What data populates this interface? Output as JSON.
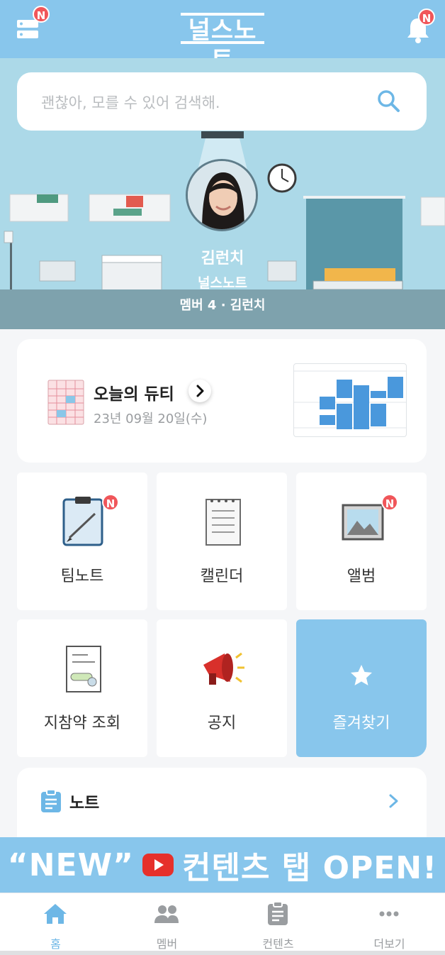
{
  "header": {
    "logo_text": "널스노트",
    "left_badge": "N",
    "right_badge": "N"
  },
  "search": {
    "placeholder": "괜찮아, 모를 수 있어 검색해."
  },
  "profile": {
    "name": "김런치",
    "team": "널스노트",
    "member_line": "멤버 4 · 김런치"
  },
  "duty": {
    "title": "오늘의 듀티",
    "date": "23년 09월 20일(수)"
  },
  "tiles": [
    {
      "label": "팀노트",
      "badge": "N"
    },
    {
      "label": "캘린더",
      "badge": ""
    },
    {
      "label": "앨범",
      "badge": "N"
    },
    {
      "label": "지참약 조회",
      "badge": ""
    },
    {
      "label": "공지",
      "badge": ""
    },
    {
      "label": "즐겨찾기",
      "badge": ""
    }
  ],
  "note": {
    "title": "노트"
  },
  "banner": {
    "left_text": "“NEW”",
    "right_text": "컨텐츠 탭 OPEN!"
  },
  "bottom_nav": [
    {
      "label": "홈",
      "icon": "home-icon"
    },
    {
      "label": "멤버",
      "icon": "people-icon"
    },
    {
      "label": "컨텐츠",
      "icon": "clipboard-icon"
    },
    {
      "label": "더보기",
      "icon": "more-icon"
    }
  ],
  "colors": {
    "primary": "#88c6ec",
    "badge": "#f0565a",
    "active_nav": "#6db7e6"
  }
}
